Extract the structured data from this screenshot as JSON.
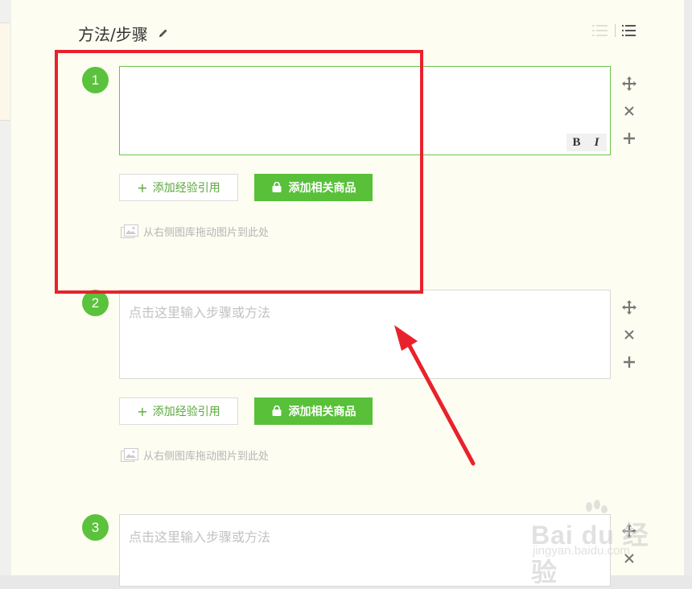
{
  "section": {
    "title": "方法/步骤"
  },
  "steps": [
    {
      "number": "1",
      "placeholder": "",
      "cite_label": "添加经验引用",
      "goods_label": "添加相关商品",
      "drag_hint": "从右侧图库拖动图片到此处",
      "format_bold": "B",
      "format_italic": "I"
    },
    {
      "number": "2",
      "placeholder": "点击这里输入步骤或方法",
      "cite_label": "添加经验引用",
      "goods_label": "添加相关商品",
      "drag_hint": "从右侧图库拖动图片到此处"
    },
    {
      "number": "3",
      "placeholder": "点击这里输入步骤或方法"
    }
  ],
  "watermark": {
    "logo": "Bai du 经验",
    "url": "jingyan.baidu.com"
  },
  "colors": {
    "accent_green": "#59c03a",
    "annotation_red": "#e8222c",
    "panel_bg": "#fdfdf1"
  },
  "icons": [
    "pencil-icon",
    "numbered-list-icon",
    "bullet-list-icon",
    "move-icon",
    "close-icon",
    "plus-icon",
    "bag-icon",
    "image-icon"
  ]
}
